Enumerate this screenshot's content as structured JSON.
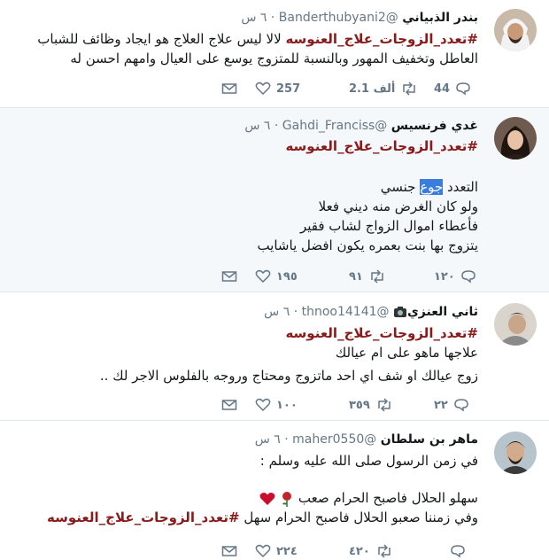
{
  "tweets": [
    {
      "name": "بندر الذبياني",
      "handle": "@Banderthubyani2",
      "time": "٦ س",
      "hashtag": "#تعدد_الزوجات_علاج_العنوسه",
      "line1_rest": " لالا ليس علاج العلاج هو ايجاد وظائف للشباب",
      "line2": "العاطل وتخفيف المهور وبالنسبة للمتزوج  يوسع على العيال وامهم احسن له",
      "replies": "44",
      "retweets": "2.1 ألف",
      "likes": "257"
    },
    {
      "name": "غدي فرنسيس",
      "handle": "@Gahdi_Franciss",
      "time": "٦ س",
      "hashtag": "#تعدد_الزوجات_علاج_العنوسه",
      "line1_a": "التعدد ",
      "line1_sel": "جوع",
      "line1_b": " جنسي",
      "line2": "ولو كان الغرض منه ديني فعلا",
      "line3": "فأعطاء اموال الزواج لشاب فقير",
      "line4": "يتزوج بها بنت بعمره يكون افضل ياشايب",
      "replies": "١٢٠",
      "retweets": "٩١",
      "likes": "١٩٥"
    },
    {
      "name": "ثاني العنزي",
      "handle": "@thnoo14141",
      "time": "٦ س",
      "hashtag": "#تعدد_الزوجات_علاج_العنوسه",
      "line2": "علاجها ماهو على ام عيالك",
      "line3": "زوج عيالك او شف اي احد ماتزوج ومحتاج وروجه بالفلوس الاجر لك ..",
      "replies": "٢٢",
      "retweets": "٣٥٩",
      "likes": "١٠٠"
    },
    {
      "name": "ماهر بن سلطان",
      "handle": "@maher0550",
      "time": "٦ س",
      "line1": "في زمن الرسول صلى الله عليه وسلم :",
      "line2": "سهلو الحلال فاصبح الحرام صعب",
      "line3_text": "وفي زمننا صعبو الحلال فاصبح الحرام سهل ",
      "hashtag": "#تعدد_الزوجات_علاج_العنوسه",
      "retweets": "٤٢٠",
      "likes": "٢٢٤"
    }
  ],
  "colors": {
    "hashtag": "#8b1a1a",
    "muted": "#657786",
    "highlight_bg": "#f5f8fa",
    "selection": "#3b7ddd"
  }
}
